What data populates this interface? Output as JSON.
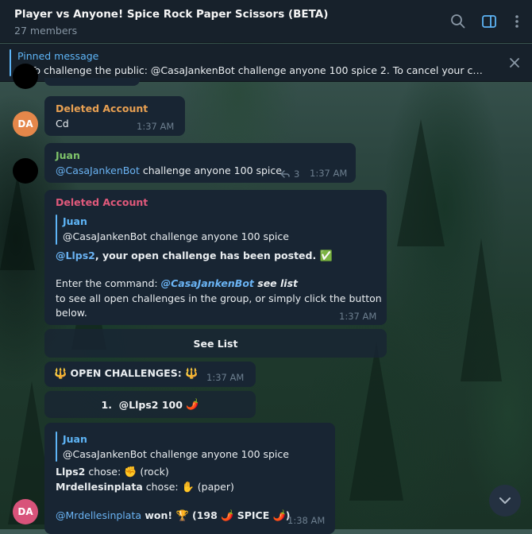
{
  "header": {
    "title": "Player vs Anyone! Spice Rock Paper Scissors (BETA)",
    "members": "27 members"
  },
  "pinned": {
    "title": "Pinned message",
    "text": "1. To challenge the public: @CasaJankenBot challenge anyone 100 spice  2. To cancel your challe..."
  },
  "messages": {
    "deleted1": {
      "avatar": "DA",
      "sender": "Deleted Account",
      "text": "Cd",
      "time": "1:37 AM"
    },
    "juan1": {
      "sender": "Juan",
      "mention": "@CasaJankenBot",
      "text": " challenge anyone 100 spice",
      "replies": "3",
      "time": "1:37 AM"
    },
    "bot1": {
      "sender": "Deleted Account",
      "quote_sender": "Juan",
      "quote_text": "@CasaJankenBot challenge anyone 100 spice",
      "line1_mention": "@Llps2",
      "line1_text": ", your open challenge has been posted.",
      "line1_emoji": "✅",
      "line2_prefix": "Enter the command: ",
      "line2_cmd": "@CasaJankenBot",
      "line2_cmd2": " see list",
      "line3": "to see all open challenges in the group, or simply click the button",
      "line4": "below.",
      "time": "1:37 AM",
      "button": "See List"
    },
    "bot2": {
      "emoji_left": "🔱",
      "text": " OPEN CHALLENGES: ",
      "emoji_right": "🔱",
      "time": "1:37 AM",
      "button_num": "1.",
      "button_text": "@Llps2 100",
      "button_emoji": "🌶️"
    },
    "bot3": {
      "avatar": "DA",
      "quote_sender": "Juan",
      "quote_text": "@CasaJankenBot challenge anyone 100 spice",
      "line1_name": "Llps2",
      "line1_text": " chose: ",
      "line1_emoji": "✊",
      "line1_move": " (rock)",
      "line2_name": "Mrdellesinplata",
      "line2_text": " chose: ",
      "line2_emoji": "✋",
      "line2_move": " (paper)",
      "line3_mention": "@Mrdellesinplata",
      "line3_text": " won! ",
      "line3_emoji": "🏆",
      "line3_pre": " (198 ",
      "line3_chili1": "🌶️",
      "line3_spice": " SPICE ",
      "line3_chili2": "🌶️",
      "line3_post": ")",
      "time": "1:38 AM"
    },
    "partial_time": "1:37 AM"
  },
  "colors": {
    "accent": "#5eb5f7",
    "avatar_orange": "#e5874a",
    "avatar_pink": "#d8537a",
    "juan_green": "#7fc46a",
    "deleted_orange": "#e8a052",
    "deleted_pink": "#e0597b"
  },
  "icons": [
    "search-icon",
    "sidebar-toggle-icon",
    "more-vertical-icon",
    "close-icon",
    "reply-arrow-icon",
    "chevron-down-icon"
  ]
}
